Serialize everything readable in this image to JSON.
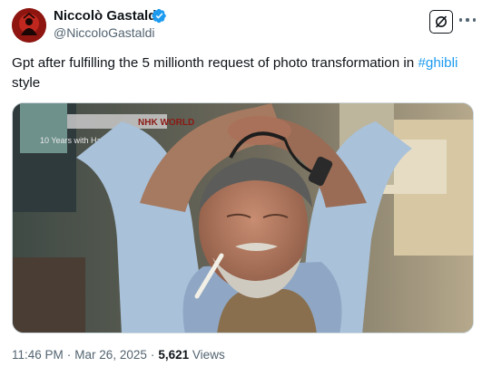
{
  "author": {
    "name": "Niccolò Gastaldi",
    "handle": "@NiccoloGastaldi",
    "verified": true
  },
  "tweet": {
    "text_before": "Gpt after fulfilling the 5 millionth request of photo transformation in ",
    "hashtag": "#ghibli",
    "text_after": " style"
  },
  "media": {
    "broadcaster": "NHK WORLD",
    "caption": "10 Years with Hayao Mi"
  },
  "meta": {
    "time": "11:46 PM",
    "separator": "·",
    "date": "Mar 26, 2025",
    "views_count": "5,621",
    "views_label": "Views"
  },
  "icons": {
    "verified": "verified-badge-icon",
    "grok": "grok-icon",
    "more": "more-options-icon"
  },
  "colors": {
    "accent": "#1d9bf0",
    "text": "#0f1419",
    "secondary": "#536471"
  }
}
